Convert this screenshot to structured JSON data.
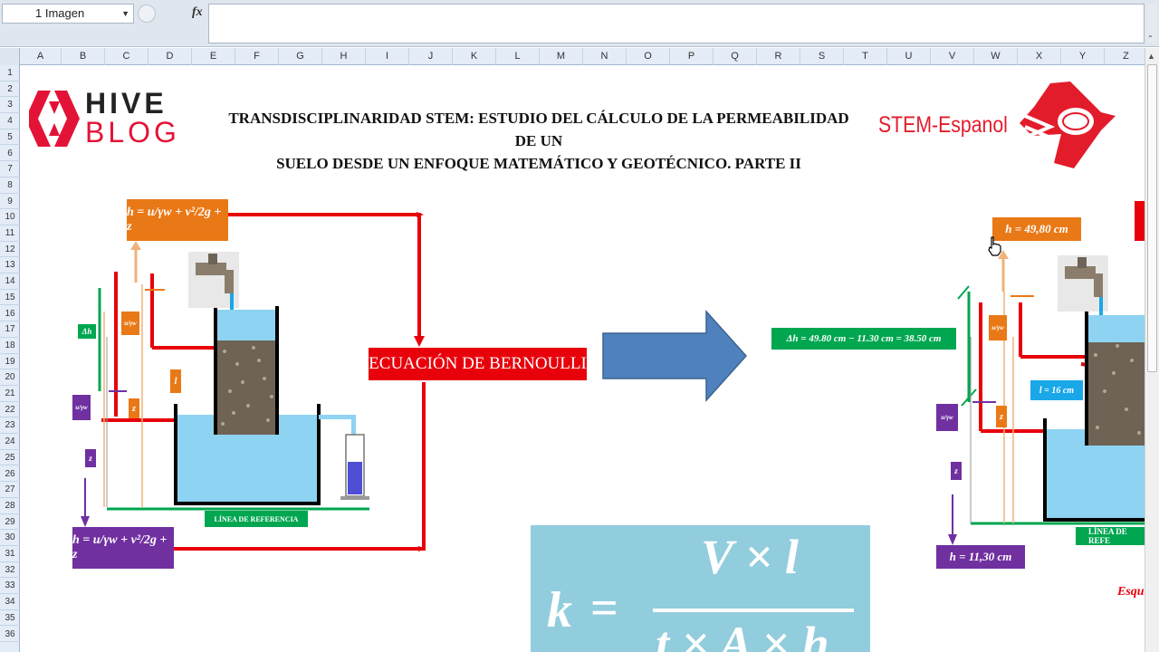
{
  "name_box": {
    "value": "1 Imagen"
  },
  "formula_bar": {
    "fx_label": "fx",
    "value": ""
  },
  "columns": [
    "A",
    "B",
    "C",
    "D",
    "E",
    "F",
    "G",
    "H",
    "I",
    "J",
    "K",
    "L",
    "M",
    "N",
    "O",
    "P",
    "Q",
    "R",
    "S",
    "T",
    "U",
    "V",
    "W",
    "X",
    "Y",
    "Z"
  ],
  "rows": [
    "1",
    "2",
    "3",
    "4",
    "5",
    "6",
    "7",
    "8",
    "9",
    "10",
    "11",
    "12",
    "13",
    "14",
    "15",
    "16",
    "17",
    "18",
    "19",
    "20",
    "21",
    "22",
    "23",
    "24",
    "25",
    "26",
    "27",
    "28",
    "29",
    "30",
    "31",
    "32",
    "33",
    "34",
    "35",
    "36"
  ],
  "sheet": {
    "title_line1": "TRANSDISCIPLINARIDAD STEM: ESTUDIO DEL CÁLCULO DE LA  PERMEABILIDAD DE UN",
    "title_line2": "SUELO  DESDE UN ENFOQUE MATEMÁTICO Y GEOTÉCNICO. PARTE II",
    "hive_logo": {
      "line1": "HIVE",
      "line2": "BLOG"
    },
    "stem_logo": {
      "text": "STEM-Espanol"
    },
    "bernoulli_label": "ECUACIÓN DE BERNOULLI",
    "left_diagram": {
      "top_equation": "h = u/γw + v²/2g + z",
      "bottom_equation": "h = u/γw + v²/2g + z",
      "delta_h_label": "Δh",
      "l_label": "l",
      "z_label": "z",
      "u_gamma_label": "u/γw",
      "reference_label": "LÍNEA DE REFERENCIA"
    },
    "right_diagram": {
      "h_top": "h = 49,80 cm",
      "delta_h": "Δh = 49.80 cm − 11.30 cm = 38.50 cm",
      "l_value": "l = 16 cm",
      "z_label": "z",
      "u_gamma_label": "u/γw",
      "h_bottom": "h = 11,30 cm",
      "reference_label": "LÍNEA DE REFE"
    },
    "k_formula": {
      "k": "k",
      "equals": "=",
      "numerator": "V × l",
      "denominator": "t × A × h"
    },
    "partial_red_text": "Esqu"
  },
  "colors": {
    "red": "#e8000b",
    "orange": "#e97917",
    "purple": "#7030a0",
    "green": "#00a650",
    "arrow_blue": "#4f81bd",
    "water": "#8ed3f2",
    "k_box": "#92cddd"
  }
}
